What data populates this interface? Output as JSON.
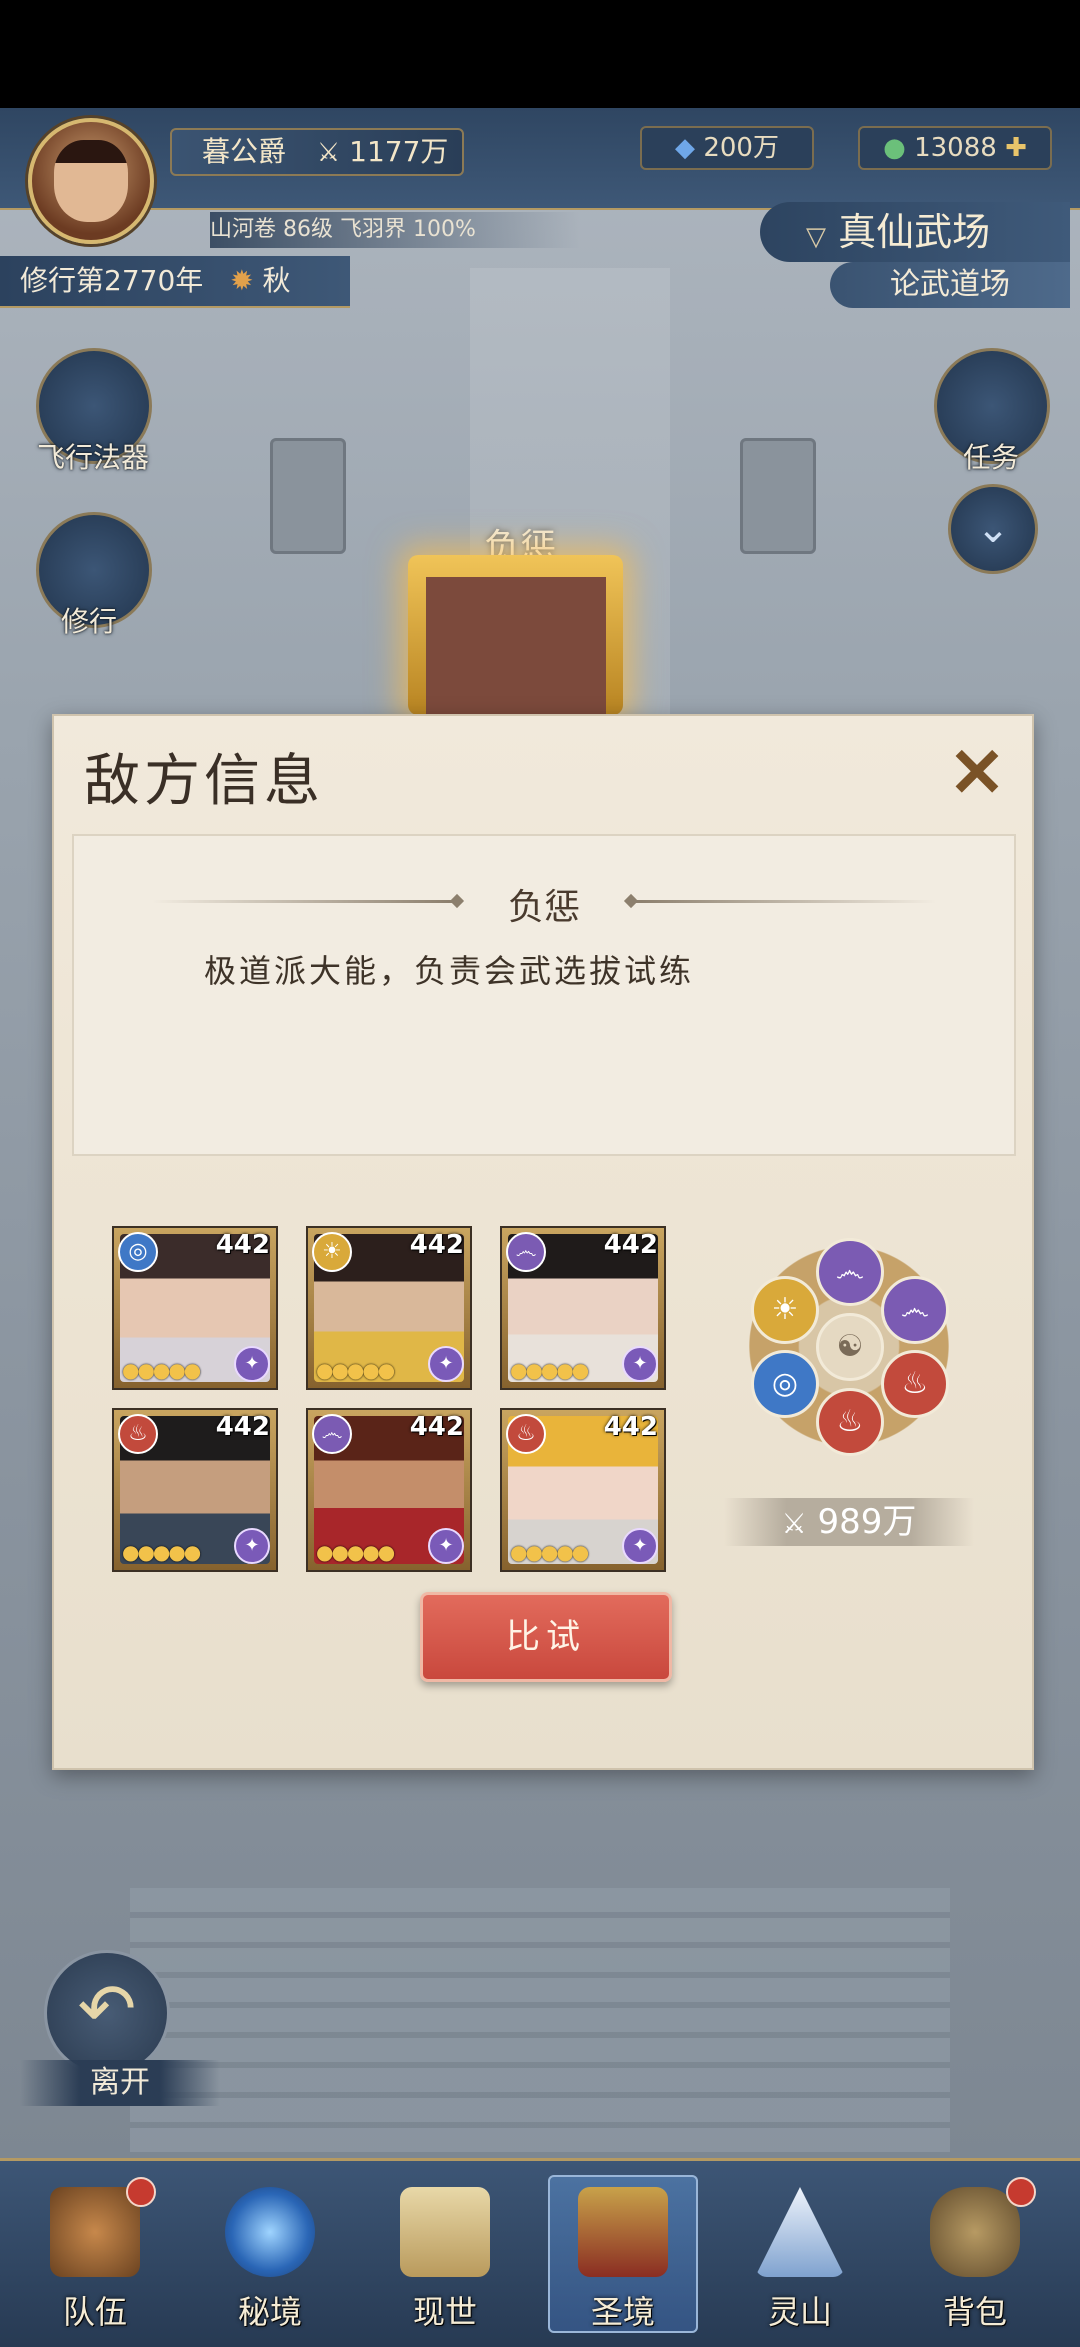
{
  "header": {
    "title_rank": "暮公爵",
    "combat_power": "1177万",
    "resource_crystal": "200万",
    "resource_jade": "13088",
    "sub_info": "山河卷 86级 飞羽界 100%",
    "cultivation_year": "修行第2770年",
    "season": "秋",
    "location_main": "真仙武场",
    "location_sub": "论武道场"
  },
  "side_buttons": {
    "flying_artifact": "飞行法器",
    "cultivate": "修行",
    "quest": "任务"
  },
  "scene": {
    "npc_name": "负惩"
  },
  "dialog": {
    "title": "敌方信息",
    "enemy_name": "负惩",
    "enemy_desc": "极道派大能，负责会武选拔试练",
    "team": [
      {
        "level": "442",
        "element": "water",
        "stars": 5
      },
      {
        "level": "442",
        "element": "light",
        "stars": 5
      },
      {
        "level": "442",
        "element": "wind",
        "stars": 5
      },
      {
        "level": "442",
        "element": "fire",
        "stars": 5
      },
      {
        "level": "442",
        "element": "wind",
        "stars": 5
      },
      {
        "level": "442",
        "element": "fire",
        "stars": 5
      }
    ],
    "team_power": "989万",
    "fight_button": "比试"
  },
  "leave_button": "离开",
  "bottom_nav": [
    {
      "label": "队伍",
      "icon": "team-icon",
      "dot": true
    },
    {
      "label": "秘境",
      "icon": "secret-realm-icon",
      "dot": false
    },
    {
      "label": "现世",
      "icon": "world-map-icon",
      "dot": false
    },
    {
      "label": "圣境",
      "icon": "holy-realm-icon",
      "dot": false,
      "active": true
    },
    {
      "label": "灵山",
      "icon": "spirit-mountain-icon",
      "dot": false
    },
    {
      "label": "背包",
      "icon": "bag-icon",
      "dot": true
    }
  ],
  "colors": {
    "water": "#3f78c6",
    "light": "#d9a93a",
    "wind": "#7b5bb3",
    "fire": "#c24a3c"
  }
}
